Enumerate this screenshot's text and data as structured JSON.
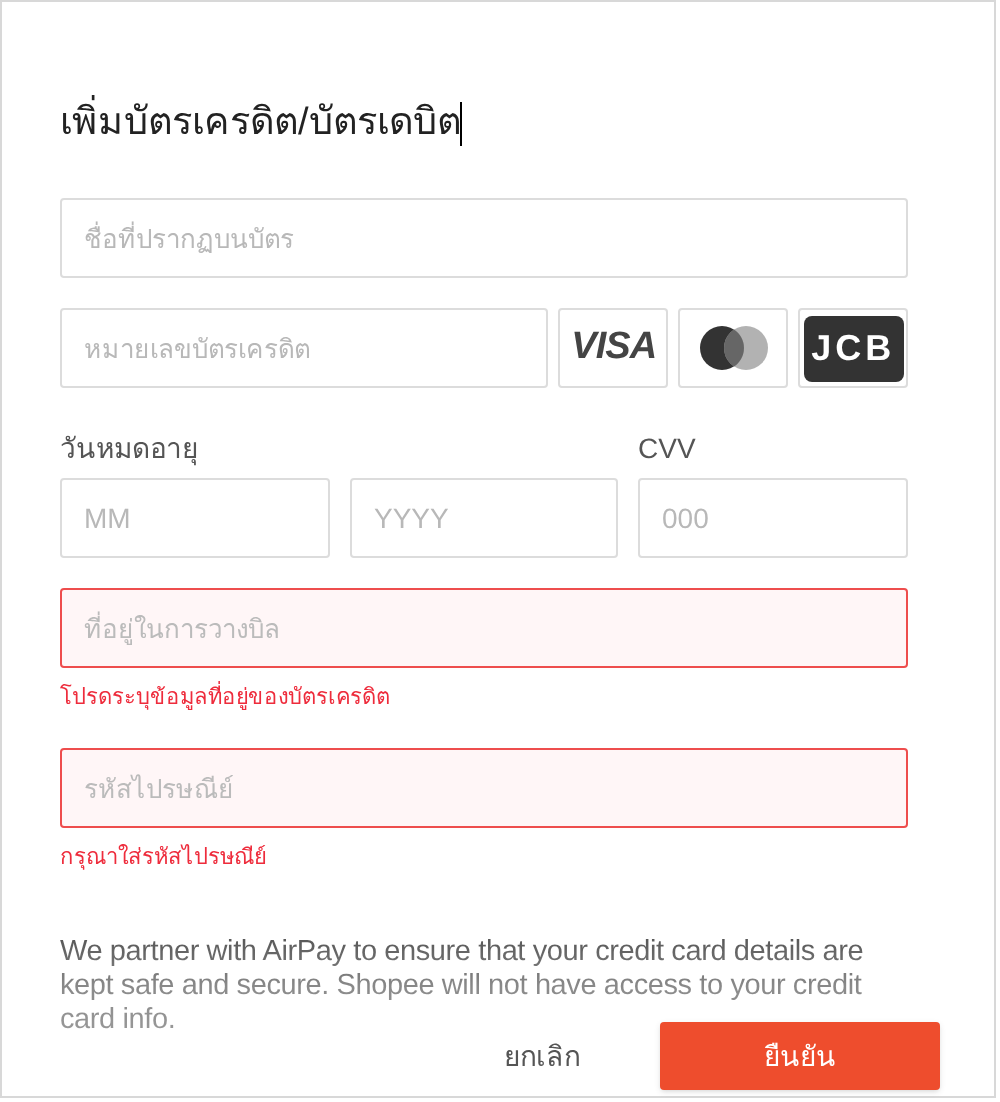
{
  "dialog": {
    "title": "เพิ่มบัตรเครดิต/บัตรเดบิต"
  },
  "name_field": {
    "placeholder": "ชื่อที่ปรากฏบนบัตร",
    "invalid": false
  },
  "card_number_field": {
    "placeholder": "หมายเลขบัตรเครดิต",
    "invalid": false
  },
  "card_brands": [
    {
      "kind": "visa",
      "label": "VISA"
    },
    {
      "kind": "mastercard"
    },
    {
      "kind": "jcb",
      "label": "JCB"
    }
  ],
  "expiry": {
    "label": "วันหมดอายุ",
    "month_placeholder": "MM",
    "year_placeholder": "YYYY"
  },
  "cvv": {
    "label": "CVV",
    "placeholder": "000"
  },
  "address_field": {
    "placeholder": "ที่อยู่ในการวางบิล",
    "invalid": true,
    "error": "โปรดระบุข้อมูลที่อยู่ของบัตรเครดิต"
  },
  "postal_field": {
    "placeholder": "รหัสไปรษณีย์",
    "invalid": true,
    "error": "กรุณาใส่รหัสไปรษณีย์"
  },
  "notice": "We partner with AirPay to ensure that your credit card details are kept safe and secure. Shopee will not have access to your credit card info.",
  "buttons": [
    {
      "label": "ยกเลิก",
      "kind": "secondary"
    },
    {
      "label": "ยืนยัน",
      "kind": "primary"
    }
  ]
}
